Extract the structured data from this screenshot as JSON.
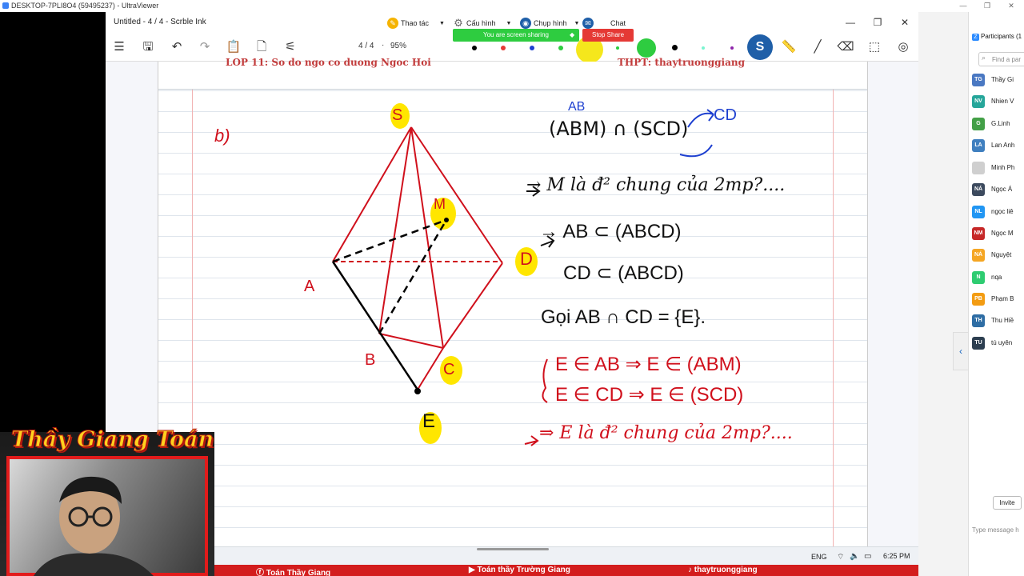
{
  "outer_window": {
    "title": "DESKTOP-7PLI8O4 (59495237) - UltraViewer"
  },
  "app": {
    "title": "Untitled - 4 / 4 - Scrble Ink",
    "menus": [
      {
        "label": "Thao tác",
        "icon": "pencil-icon",
        "color": "#f5b301"
      },
      {
        "label": "Cấu hình",
        "icon": "gear-icon",
        "color": "#666666"
      },
      {
        "label": "Chụp hình",
        "icon": "camera-icon",
        "color": "#1f5fa8"
      },
      {
        "label": "Chat",
        "icon": "chat-icon",
        "color": "#1f5fa8"
      }
    ],
    "share_status": "You are screen sharing",
    "stop_share_label": "Stop Share"
  },
  "toolbar": {
    "page": "4 / 4",
    "zoom": "95%",
    "pen_colors": [
      "#000000",
      "#e53935",
      "#1e40d0",
      "#2ecc40",
      "#f5e71c",
      "#2ecc40",
      "#000000",
      "#7bf4d0",
      "#8e24aa"
    ],
    "accent": "#1f5fa8"
  },
  "board": {
    "header_left": "LOP 11: So do ngo co duong Ngoc Hoi",
    "header_right": "THPT: thaytruonggiang",
    "labels": {
      "part": "b)",
      "S": "S",
      "M": "M",
      "A": "A",
      "D": "D",
      "B": "B",
      "C": "C",
      "E": "E"
    },
    "notes": {
      "line1": "(ABM) ∩ (SCD)",
      "line1_blue_top": "AB",
      "line1_blue_right": "CD",
      "line2": "→ M là đ² chung của 2mp?....",
      "line3": "→ AB ⊂ (ABCD)",
      "line4": "CD ⊂ (ABCD)",
      "line5": "Gọi AB ∩ CD = {E}.",
      "line6": "E ∈ AB ⇒ E ∈ (ABM)",
      "line7": "E ∈ CD ⇒ E ∈ (SCD)",
      "line8": "⇒ E là đ² chung của 2mp?...."
    }
  },
  "taskbar": {
    "lang": "ENG",
    "time": "6:25 PM"
  },
  "participants": {
    "title": "Participants (1",
    "search_placeholder": "Find a par",
    "list": [
      {
        "initials": "TG",
        "name": "Thầy Gi",
        "color": "#4a78c2"
      },
      {
        "initials": "NV",
        "name": "Nhien V",
        "color": "#26a69a"
      },
      {
        "initials": "G",
        "name": "G.Linh",
        "color": "#43a047"
      },
      {
        "initials": "LA",
        "name": "Lan Anh",
        "color": "#3f7fbf"
      },
      {
        "initials": "",
        "name": "Minh Ph",
        "color": "#cfcfcf"
      },
      {
        "initials": "NÁ",
        "name": "Ngọc Á",
        "color": "#3c4a5e"
      },
      {
        "initials": "NL",
        "name": "ngọc liê",
        "color": "#2196f3"
      },
      {
        "initials": "NM",
        "name": "Ngọc M",
        "color": "#c62828"
      },
      {
        "initials": "NÁ",
        "name": "Nguyệt",
        "color": "#f5a623"
      },
      {
        "initials": "N",
        "name": "nqa",
        "color": "#2ecc71"
      },
      {
        "initials": "PB",
        "name": "Phạm B",
        "color": "#f39c12"
      },
      {
        "initials": "TH",
        "name": "Thu Hiề",
        "color": "#2e6da4"
      },
      {
        "initials": "TU",
        "name": "tú uyên",
        "color": "#2c3e50"
      }
    ],
    "invite_label": "Invite",
    "type_message": "Type message h"
  },
  "webcam": {
    "banner": "Thầy Giang Toán"
  },
  "bottom_strip": {
    "items": [
      "Toán Thầy Giang",
      "Toán thầy Trường Giang",
      "thaytruonggiang"
    ]
  }
}
